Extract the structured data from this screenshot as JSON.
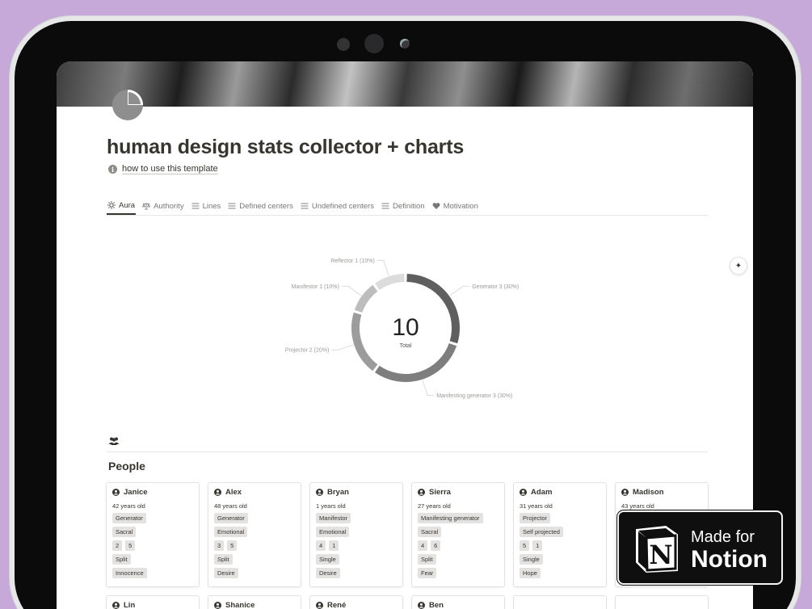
{
  "page": {
    "title": "human design stats collector + charts",
    "howto_label": "how to use this template"
  },
  "tabs": [
    {
      "label": "Aura",
      "icon": "sun-icon",
      "active": true
    },
    {
      "label": "Authority",
      "icon": "scale-icon",
      "active": false
    },
    {
      "label": "Lines",
      "icon": "list-icon",
      "active": false
    },
    {
      "label": "Defined centers",
      "icon": "list-icon",
      "active": false
    },
    {
      "label": "Undefined centers",
      "icon": "list-icon",
      "active": false
    },
    {
      "label": "Definition",
      "icon": "list-icon",
      "active": false
    },
    {
      "label": "Motivation",
      "icon": "heart-icon",
      "active": false
    }
  ],
  "chart_data": {
    "type": "pie",
    "center_value": "10",
    "center_label": "Total",
    "slices": [
      {
        "label": "Generator",
        "count": 3,
        "percent": "30%",
        "color": "#5f5f5f"
      },
      {
        "label": "Manifesting generator",
        "count": 3,
        "percent": "30%",
        "color": "#7e7e7e"
      },
      {
        "label": "Projector",
        "count": 2,
        "percent": "20%",
        "color": "#9c9c9c"
      },
      {
        "label": "Manifestor",
        "count": 1,
        "percent": "10%",
        "color": "#bdbdbd"
      },
      {
        "label": "Reflector",
        "count": 1,
        "percent": "10%",
        "color": "#dcdcdc"
      }
    ],
    "slice_labels": [
      "Generator  3 (30%)",
      "Manifesting generator  3 (30%)",
      "Projector  2 (20%)",
      "Manifestor  1 (10%)",
      "Reflector  1 (10%)"
    ]
  },
  "people_section": {
    "heading": "People",
    "cards": [
      {
        "name": "Janice",
        "age": "42 years old",
        "aura": "Generator",
        "authority": "Sacral",
        "lines": [
          "2",
          "5"
        ],
        "definition": "Split",
        "motivation": "Innocence"
      },
      {
        "name": "Alex",
        "age": "48 years old",
        "aura": "Generator",
        "authority": "Emotional",
        "lines": [
          "3",
          "5"
        ],
        "definition": "Split",
        "motivation": "Desire"
      },
      {
        "name": "Bryan",
        "age": "1 years old",
        "aura": "Manifestor",
        "authority": "Emotional",
        "lines": [
          "4",
          "1"
        ],
        "definition": "Single",
        "motivation": "Desire"
      },
      {
        "name": "Sierra",
        "age": "27 years old",
        "aura": "Manifesting generator",
        "authority": "Sacral",
        "lines": [
          "4",
          "6"
        ],
        "definition": "Split",
        "motivation": "Fear"
      },
      {
        "name": "Adam",
        "age": "31 years old",
        "aura": "Projector",
        "authority": "Self projected",
        "lines": [
          "5",
          "1"
        ],
        "definition": "Single",
        "motivation": "Hope"
      },
      {
        "name": "Madison",
        "age": "43 years old",
        "aura": "",
        "authority": "",
        "lines": [],
        "definition": "",
        "motivation": ""
      }
    ],
    "second_row": [
      "Lin",
      "Shanice",
      "René",
      "Ben",
      "",
      ""
    ]
  },
  "badge": {
    "line1": "Made for",
    "line2": "Notion"
  }
}
